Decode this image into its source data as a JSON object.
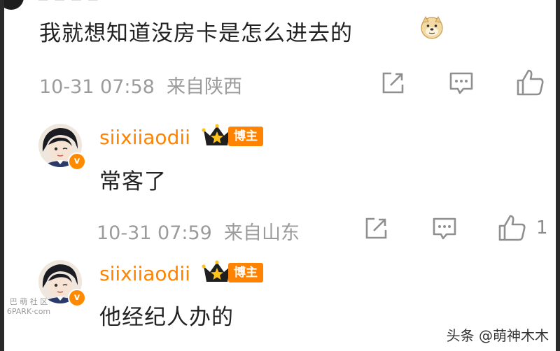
{
  "top_partial": {
    "text": "— — — —"
  },
  "comments": [
    {
      "text": "我就想知道没房卡是怎么进去的",
      "emoji": "doge-emoji",
      "meta": {
        "time": "10-31 07:58",
        "location": "来自陕西"
      },
      "actions": {
        "share": "share-icon",
        "reply": "comment-icon",
        "like": "like-icon"
      }
    }
  ],
  "replies": [
    {
      "username": "siixiiaodii",
      "role": "博主",
      "text": "常客了",
      "meta": {
        "time": "10-31 07:59",
        "location": "来自山东"
      },
      "like_count": "1"
    },
    {
      "username": "siixiiaodii",
      "role": "博主",
      "text": "他经纪人办的"
    }
  ],
  "watermark": {
    "line1": "巴 萌 社 区",
    "line2": "6PARK·com"
  },
  "brand": {
    "text": "头条 @萌神木木"
  },
  "colors": {
    "accent": "#ff8200",
    "meta": "#9b9b9b",
    "text": "#222222"
  }
}
